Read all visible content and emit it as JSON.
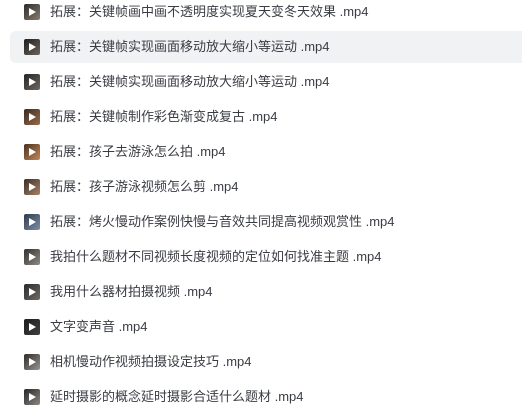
{
  "files": [
    {
      "name": "拓展：关键帧画中画不透明度实现夏天变冬天效果 .mp4",
      "thumb_colors": [
        "#2b2b2b",
        "#8a7d6e"
      ],
      "selected": false
    },
    {
      "name": "拓展：关键帧实现画面移动放大缩小等运动 .mp4",
      "thumb_colors": [
        "#1e1e1e",
        "#6b6560"
      ],
      "selected": true
    },
    {
      "name": "拓展：关键帧实现画面移动放大缩小等运动 .mp4",
      "thumb_colors": [
        "#242424",
        "#6f6861"
      ],
      "selected": false
    },
    {
      "name": "拓展：关键帧制作彩色渐变成复古 .mp4",
      "thumb_colors": [
        "#3a2a22",
        "#9b6a4a"
      ],
      "selected": false
    },
    {
      "name": "拓展：孩子去游泳怎么拍 .mp4",
      "thumb_colors": [
        "#4a3020",
        "#c28a5a"
      ],
      "selected": false
    },
    {
      "name": "拓展：孩子游泳视频怎么剪 .mp4",
      "thumb_colors": [
        "#3b2d25",
        "#a88366"
      ],
      "selected": false
    },
    {
      "name": "拓展：烤火慢动作案例快慢与音效共同提高视频观赏性 .mp4",
      "thumb_colors": [
        "#2f3a4a",
        "#7d8fa8"
      ],
      "selected": false
    },
    {
      "name": "我拍什么题材不同视频长度视频的定位如何找准主题 .mp4",
      "thumb_colors": [
        "#33302e",
        "#8f8a84"
      ],
      "selected": false
    },
    {
      "name": "我用什么器材拍摄视频 .mp4",
      "thumb_colors": [
        "#2a2a2a",
        "#6e6a66"
      ],
      "selected": false
    },
    {
      "name": "文字变声音 .mp4",
      "thumb_colors": [
        "#1c1c1c",
        "#404040"
      ],
      "selected": false
    },
    {
      "name": "相机慢动作视频拍摄设定技巧 .mp4",
      "thumb_colors": [
        "#2c2c2c",
        "#9a948d"
      ],
      "selected": false
    },
    {
      "name": "延时摄影的概念延时摄影合适什么题材 .mp4",
      "thumb_colors": [
        "#272727",
        "#8c8782"
      ],
      "selected": false
    }
  ]
}
